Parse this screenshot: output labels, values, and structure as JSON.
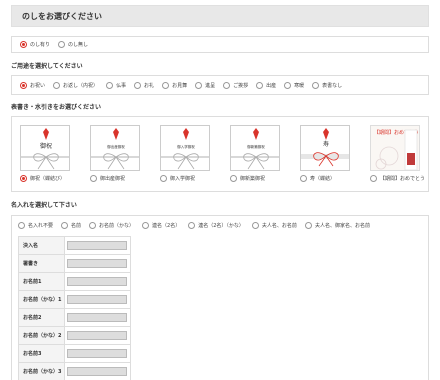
{
  "noshi_header": {
    "title": "のしをお選びください"
  },
  "noshi_presence": {
    "options": [
      {
        "label": "のし有り",
        "selected": true
      },
      {
        "label": "のし無し",
        "selected": false
      }
    ]
  },
  "purpose": {
    "heading": "ご用途を選択してください",
    "options": [
      {
        "label": "お祝い",
        "selected": true
      },
      {
        "label": "お返し（内祝）",
        "selected": false
      },
      {
        "label": "仏事",
        "selected": false
      },
      {
        "label": "お礼",
        "selected": false
      },
      {
        "label": "お見舞",
        "selected": false
      },
      {
        "label": "進呈",
        "selected": false
      },
      {
        "label": "ご挨拶",
        "selected": false
      },
      {
        "label": "出産",
        "selected": false
      },
      {
        "label": "寒暖",
        "selected": false
      },
      {
        "label": "表書なし",
        "selected": false
      }
    ]
  },
  "omotegaki": {
    "heading": "表書き・水引きをお選びください",
    "items": [
      {
        "label": "御祝（蝶結び）",
        "word": "御祝",
        "selected": true
      },
      {
        "label": "御出産御祝",
        "word": "御出産御祝",
        "selected": false
      },
      {
        "label": "御入学御祝",
        "word": "御入学御祝",
        "selected": false
      },
      {
        "label": "御新築御祝",
        "word": "御新築御祝",
        "selected": false
      },
      {
        "label": "寿（蝶結）",
        "word": "寿",
        "selected": false
      },
      {
        "label": "【期間】おめでとう",
        "word": "【期間】おめでとう",
        "selected": false
      }
    ]
  },
  "name_entry": {
    "heading": "名入れを選択して下さい",
    "options": [
      {
        "label": "名入れ不要",
        "selected": false
      },
      {
        "label": "名前",
        "selected": false
      },
      {
        "label": "お名前（かな）",
        "selected": false
      },
      {
        "label": "連名（2名）",
        "selected": false
      },
      {
        "label": "連名（2名）（かな）",
        "selected": false
      },
      {
        "label": "夫人名、お名前",
        "selected": false
      },
      {
        "label": "夫人名、御家名、お名前",
        "selected": false
      }
    ],
    "fields": [
      {
        "label": "決入名",
        "value": ""
      },
      {
        "label": "署書き",
        "value": ""
      },
      {
        "label": "お名前1",
        "value": ""
      },
      {
        "label": "お名前（かな）1",
        "value": ""
      },
      {
        "label": "お名前2",
        "value": ""
      },
      {
        "label": "お名前（かな）2",
        "value": ""
      },
      {
        "label": "お名前3",
        "value": ""
      },
      {
        "label": "お名前（かな）3",
        "value": ""
      }
    ]
  },
  "colors": {
    "accent": "#d9342b",
    "header_bg": "#e8e8e8",
    "input_bg": "#dddddd"
  }
}
